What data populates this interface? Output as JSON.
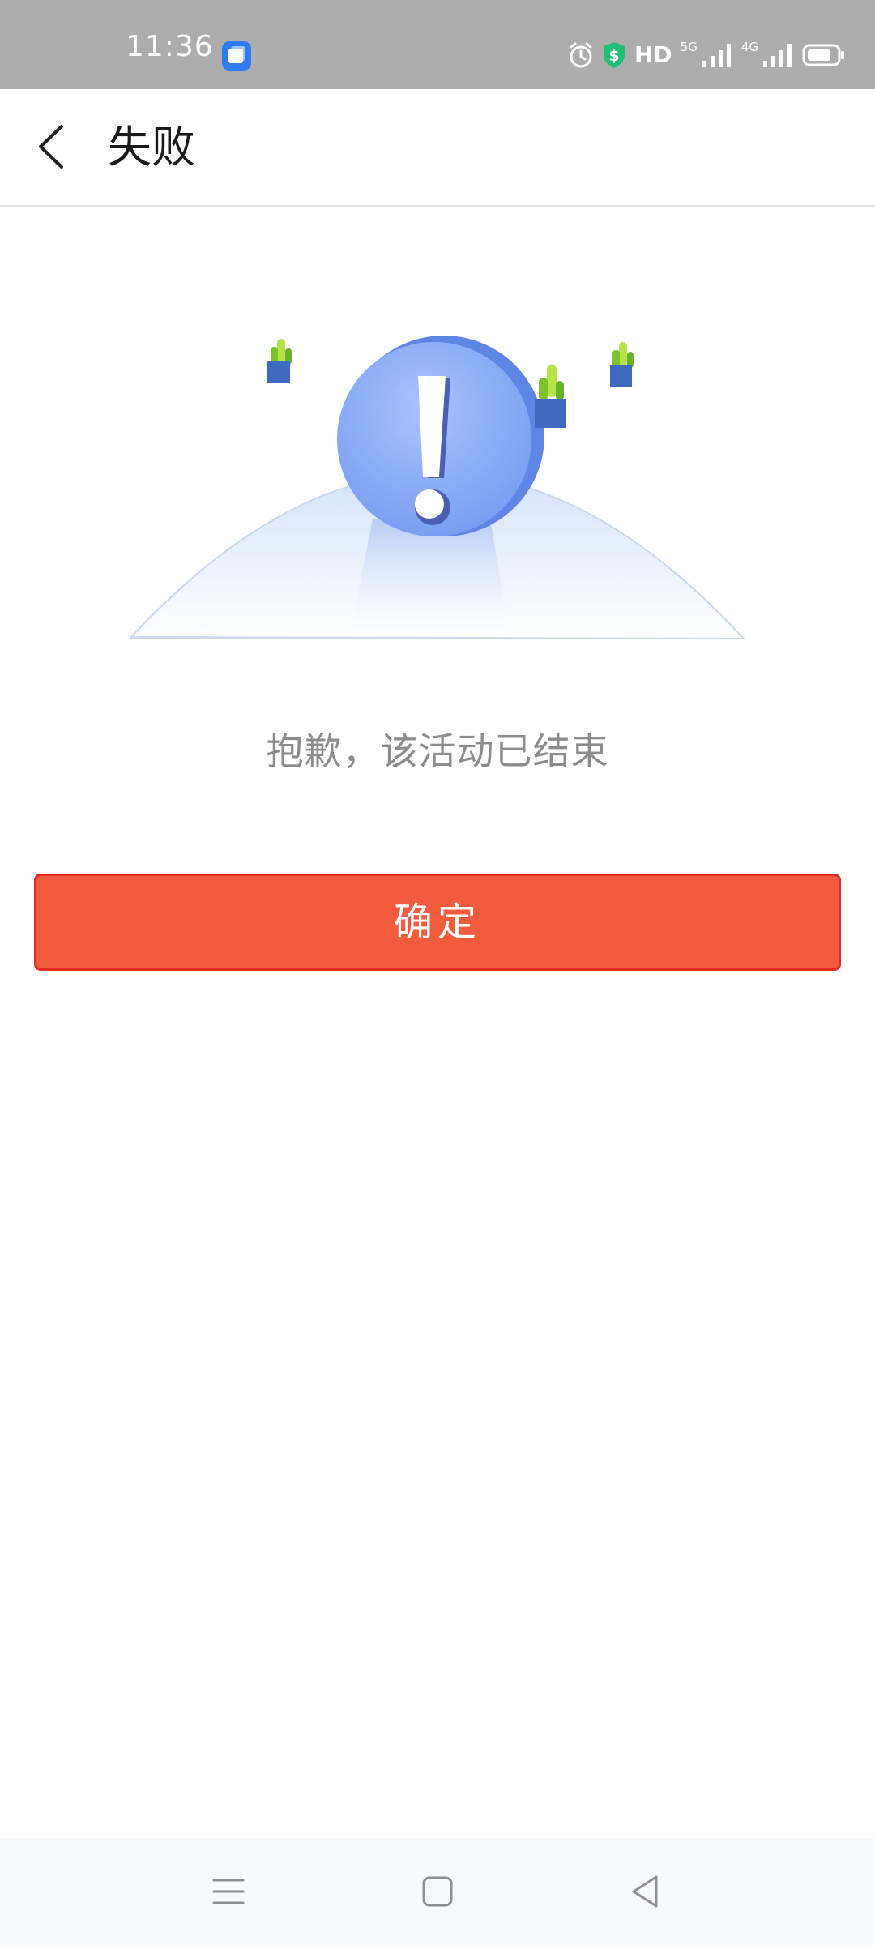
{
  "status_bar": {
    "time": "11:36",
    "hd_label": "HD",
    "network_labels": [
      "5G",
      "4G"
    ],
    "icons": [
      "app-notification-icon",
      "alarm-icon",
      "security-shield-icon",
      "signal-icon",
      "battery-icon"
    ]
  },
  "app_bar": {
    "title": "失败",
    "back_icon": "chevron-left-icon"
  },
  "illustration": {
    "icon": "exclamation-icon",
    "description_colors": {
      "circle": "#7fa3f6",
      "pot": "#3d69bf",
      "plant": "#8bd02d"
    }
  },
  "message": "抱歉，该活动已结束",
  "confirm_button": {
    "label": "确定",
    "color": "#f25b3e",
    "border_color": "#e52b22"
  },
  "nav_bar": {
    "icons": [
      "menu-icon",
      "home-icon",
      "back-triangle-icon"
    ]
  }
}
